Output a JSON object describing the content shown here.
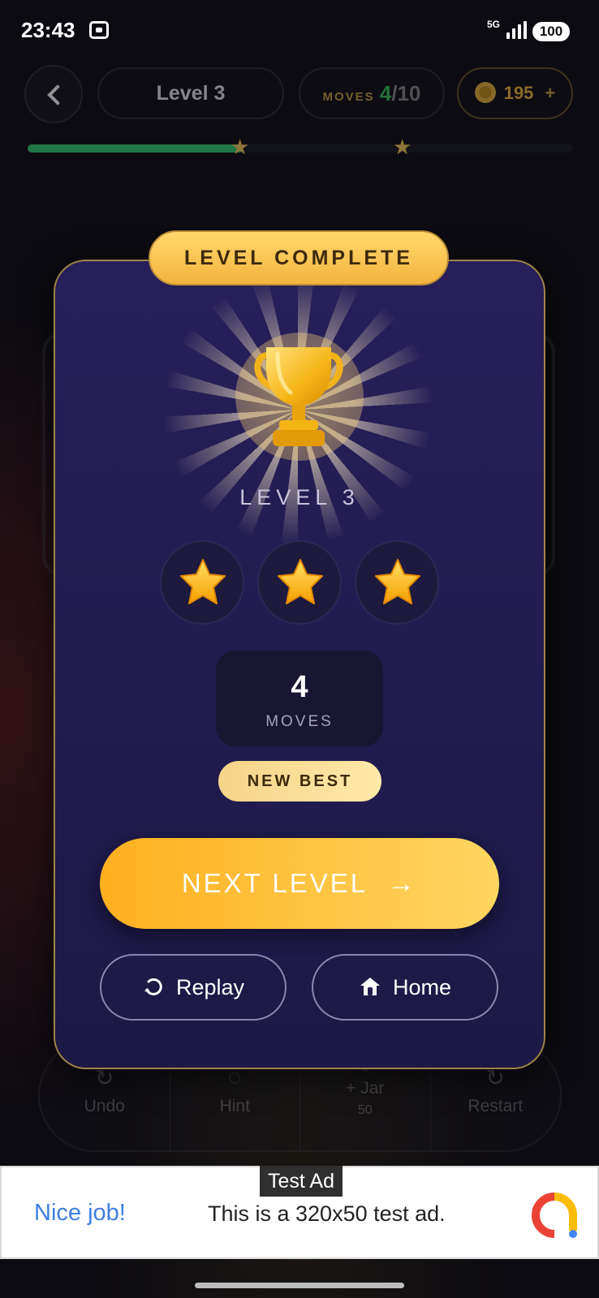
{
  "status_bar": {
    "time": "23:43",
    "network": "5G",
    "battery": "100"
  },
  "header": {
    "level_title": "Level 3",
    "moves_label": "MOVES",
    "moves_used": "4",
    "moves_total": "/10",
    "coins": "195",
    "coins_add": "+"
  },
  "progress": {
    "fill_fraction": 0.395,
    "stars": [
      "★",
      "★"
    ]
  },
  "background_toolbar": [
    {
      "label": "Undo",
      "icon": "undo-icon"
    },
    {
      "label": "Hint",
      "icon": "lightbulb-icon"
    },
    {
      "label": "+ Jar",
      "sub": "50",
      "icon": "jar-icon"
    },
    {
      "label": "Restart",
      "icon": "restart-icon"
    }
  ],
  "modal": {
    "badge": "LEVEL COMPLETE",
    "level_label": "LEVEL 3",
    "stars_earned": 3,
    "moves_count": "4",
    "moves_caption": "MOVES",
    "new_best": "NEW BEST",
    "next_button": "NEXT LEVEL",
    "next_arrow": "→",
    "replay_button": "Replay",
    "home_button": "Home"
  },
  "ad": {
    "tag": "Test Ad",
    "title": "Nice job!",
    "text": "This is a 320x50 test ad."
  },
  "colors": {
    "accent_gold": "#f3b43d",
    "modal_bg": "#271f5a",
    "progress_green": "#2ea35f",
    "moves_green": "#34c759",
    "ad_title_blue": "#3f7ee0"
  }
}
